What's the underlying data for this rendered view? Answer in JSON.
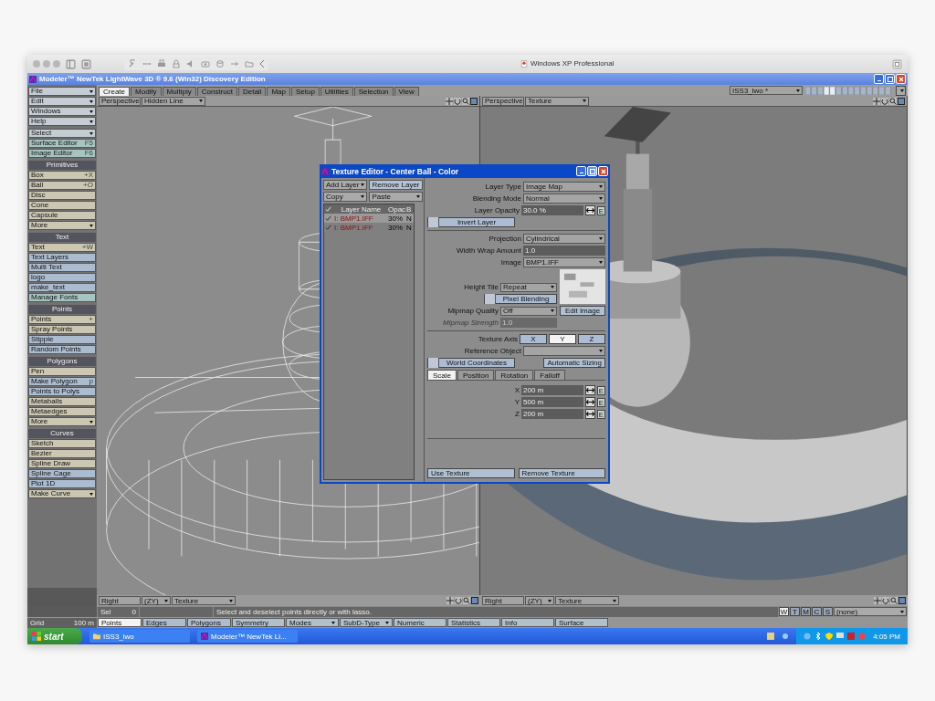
{
  "host_window": {
    "title": "Windows XP Professional"
  },
  "app_window": {
    "title": "Modeler™ NewTek LightWave 3D ® 9.6  (Win32) Discovery Edition"
  },
  "sidebar": {
    "groups": [
      {
        "items": [
          {
            "label": "File",
            "kind": "menu"
          },
          {
            "label": "Edit",
            "kind": "menu"
          },
          {
            "label": "Windows",
            "kind": "menu"
          },
          {
            "label": "Help",
            "kind": "menu"
          }
        ]
      },
      {
        "items": [
          {
            "label": "Select",
            "kind": "menu"
          },
          {
            "label": "Surface Editor",
            "kind": "panel",
            "shortcut": "F5"
          },
          {
            "label": "Image Editor",
            "kind": "panel",
            "shortcut": "F6"
          }
        ]
      },
      {
        "heading": "Primitives",
        "items": [
          {
            "label": "Box",
            "kind": "tool",
            "shortcut": "+X"
          },
          {
            "label": "Ball",
            "kind": "tool",
            "shortcut": "+O"
          },
          {
            "label": "Disc",
            "kind": "tool"
          },
          {
            "label": "Cone",
            "kind": "tool"
          },
          {
            "label": "Capsule",
            "kind": "tool"
          },
          {
            "label": "More",
            "kind": "tool-menu"
          }
        ]
      },
      {
        "heading": "Text",
        "items": [
          {
            "label": "Text",
            "kind": "tool",
            "shortcut": "+W"
          },
          {
            "label": "Text Layers",
            "kind": "command"
          },
          {
            "label": "Multi Text",
            "kind": "command"
          },
          {
            "label": "logo",
            "kind": "command"
          },
          {
            "label": "make_text",
            "kind": "command"
          },
          {
            "label": "Manage Fonts",
            "kind": "panel"
          }
        ]
      },
      {
        "heading": "Points",
        "items": [
          {
            "label": "Points",
            "kind": "tool",
            "shortcut": "+"
          },
          {
            "label": "Spray Points",
            "kind": "tool"
          },
          {
            "label": "Stipple",
            "kind": "command"
          },
          {
            "label": "Random Points",
            "kind": "command"
          }
        ]
      },
      {
        "heading": "Polygons",
        "items": [
          {
            "label": "Pen",
            "kind": "tool"
          },
          {
            "label": "Make Polygon",
            "kind": "command",
            "shortcut": "p"
          },
          {
            "label": "Points to Polys",
            "kind": "command"
          },
          {
            "label": "Metaballs",
            "kind": "tool"
          },
          {
            "label": "Metaedges",
            "kind": "tool"
          },
          {
            "label": "More",
            "kind": "tool-menu"
          }
        ]
      },
      {
        "heading": "Curves",
        "items": [
          {
            "label": "Sketch",
            "kind": "tool"
          },
          {
            "label": "Bezier",
            "kind": "tool"
          },
          {
            "label": "Spline Draw",
            "kind": "tool"
          },
          {
            "label": "Spline Cage",
            "kind": "command"
          },
          {
            "label": "Plot 1D",
            "kind": "command"
          },
          {
            "label": "Make Curve",
            "kind": "tool-menu"
          }
        ]
      }
    ]
  },
  "tabs": [
    {
      "label": "Create",
      "selected": true
    },
    {
      "label": "Modify",
      "selected": false
    },
    {
      "label": "Multiply",
      "selected": false
    },
    {
      "label": "Construct",
      "selected": false
    },
    {
      "label": "Detail",
      "selected": false
    },
    {
      "label": "Map",
      "selected": false
    },
    {
      "label": "Setup",
      "selected": false
    },
    {
      "label": "Utilities",
      "selected": false
    },
    {
      "label": "Selection",
      "selected": false
    },
    {
      "label": "View",
      "selected": false
    }
  ],
  "layer_selector": {
    "value": "ISS3_lwo *"
  },
  "viewports": [
    {
      "view": "Perspective",
      "mode": "Hidden Line",
      "kind": "wireframe"
    },
    {
      "view": "Perspective",
      "mode": "Texture",
      "kind": "textured"
    }
  ],
  "bottom_viewports": [
    {
      "view": "Right",
      "axis": "(ZY)",
      "mode": "Texture"
    },
    {
      "view": "Right",
      "axis": "(ZY)",
      "mode": "Texture"
    }
  ],
  "status": {
    "sel_label": "Sel",
    "sel_value": "0",
    "message": "Select and deselect points directly or with lasso.",
    "grid_label": "Grid",
    "grid_value": "100 m"
  },
  "selection_modes": [
    {
      "label": "Points",
      "selected": true
    },
    {
      "label": "Edges",
      "selected": false
    },
    {
      "label": "Polygons",
      "selected": false
    }
  ],
  "commands": [
    {
      "label": "Symmetry",
      "kind": "button"
    },
    {
      "label": "Modes",
      "kind": "menu"
    },
    {
      "label": "SubD-Type",
      "kind": "menu"
    },
    {
      "label": "Numeric",
      "kind": "button"
    },
    {
      "label": "Statistics",
      "kind": "button"
    },
    {
      "label": "Info",
      "kind": "button"
    },
    {
      "label": "Surface",
      "kind": "button"
    }
  ],
  "view_flags": [
    {
      "label": "W",
      "selected": true
    },
    {
      "label": "T",
      "selected": false
    },
    {
      "label": "M",
      "selected": false
    },
    {
      "label": "C",
      "selected": false
    },
    {
      "label": "S",
      "selected": false
    }
  ],
  "surface_filter": {
    "value": "(none)"
  },
  "texture_editor": {
    "title": "Texture Editor - Center Ball - Color",
    "layer_buttons": [
      {
        "label": "Add Layer",
        "kind": "menu"
      },
      {
        "label": "Remove Layer",
        "kind": "button"
      },
      {
        "label": "Copy",
        "kind": "menu"
      },
      {
        "label": "Paste",
        "kind": "menu"
      }
    ],
    "layer_columns": [
      "Layer Name",
      "Opac",
      "B"
    ],
    "layers": [
      {
        "checked": true,
        "name": "I: BMP1.IFF",
        "opacity": "30%",
        "blend": "N",
        "selected": true
      },
      {
        "checked": true,
        "name": "I: BMP1.IFF",
        "opacity": "30%",
        "blend": "N",
        "selected": false
      }
    ],
    "layer_type": {
      "label": "Layer Type",
      "value": "Image Map"
    },
    "blending_mode": {
      "label": "Blending Mode",
      "value": "Normal"
    },
    "layer_opacity": {
      "label": "Layer Opacity",
      "value": "30.0 %",
      "envelope": "E"
    },
    "invert_layer": {
      "label": "Invert Layer",
      "checked": false
    },
    "projection": {
      "label": "Projection",
      "value": "Cylindrical"
    },
    "width_wrap": {
      "label": "Width Wrap Amount",
      "value": "1.0"
    },
    "image": {
      "label": "Image",
      "value": "BMP1.IFF"
    },
    "height_tile": {
      "label": "Height Tile",
      "value": "Repeat"
    },
    "pixel_blending": {
      "label": "Pixel Blending",
      "checked": false
    },
    "edit_image": "Edit Image",
    "mipmap_quality": {
      "label": "Mipmap Quality",
      "value": "Off"
    },
    "mipmap_strength": {
      "label": "Mipmap Strength",
      "value": "1.0",
      "disabled": true
    },
    "texture_axis": {
      "label": "Texture Axis",
      "options": [
        {
          "label": "X",
          "selected": false
        },
        {
          "label": "Y",
          "selected": true
        },
        {
          "label": "Z",
          "selected": false
        }
      ]
    },
    "reference_object": {
      "label": "Reference Object"
    },
    "world_coordinates": {
      "label": "World Coordinates",
      "checked": false
    },
    "automatic_sizing": "Automatic Sizing",
    "tabs": [
      {
        "label": "Scale",
        "selected": true
      },
      {
        "label": "Position",
        "selected": false
      },
      {
        "label": "Rotation",
        "selected": false
      },
      {
        "label": "Falloff",
        "selected": false
      }
    ],
    "vector": [
      {
        "axis": "X",
        "value": "200 m",
        "envelope": "E"
      },
      {
        "axis": "Y",
        "value": "500 m",
        "envelope": "E"
      },
      {
        "axis": "Z",
        "value": "200 m",
        "envelope": "E"
      }
    ],
    "footer_buttons": [
      "Use Texture",
      "Remove Texture"
    ]
  },
  "taskbar": {
    "start": "start",
    "items": [
      {
        "label": "ISS3_lwo",
        "kind": "folder"
      },
      {
        "label": "Modeler™ NewTek Li...",
        "kind": "app"
      }
    ],
    "clock": "4:05 PM"
  }
}
